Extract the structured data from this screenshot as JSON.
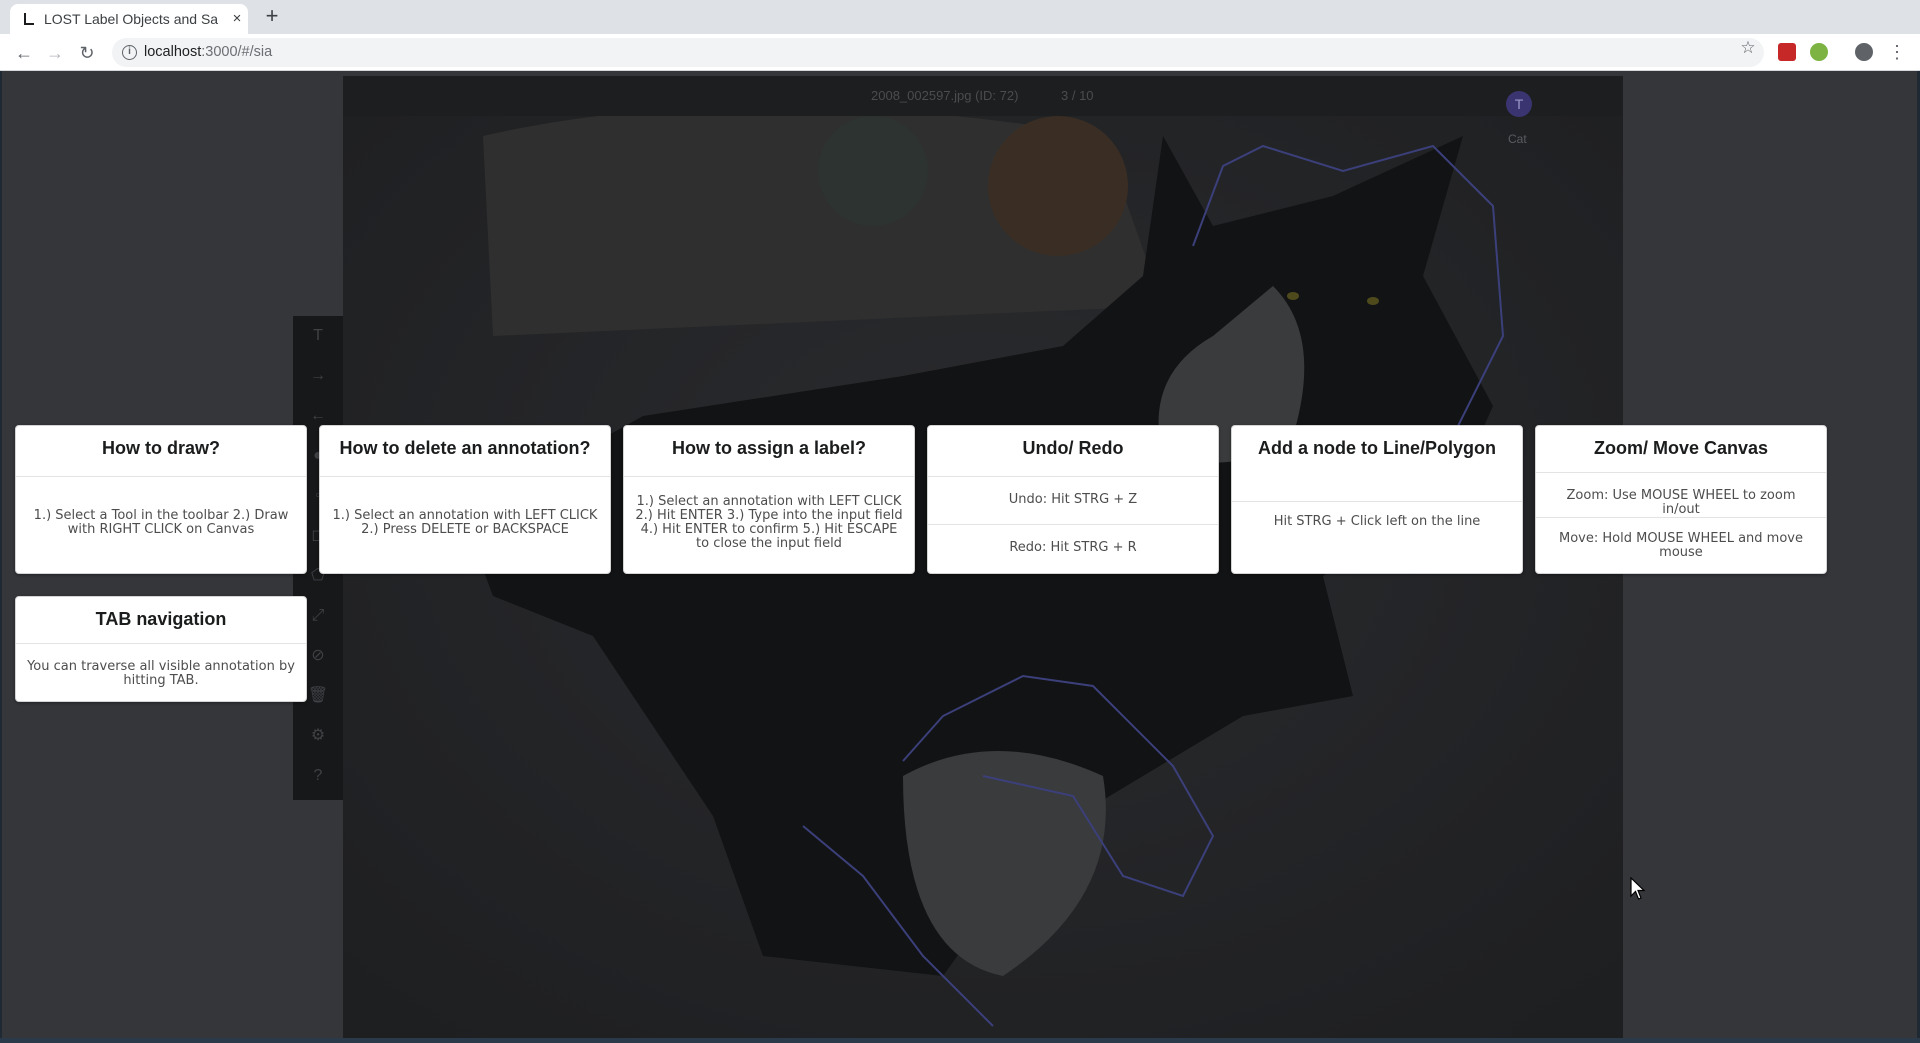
{
  "browser": {
    "tab_title": "LOST Label Objects and Sa",
    "new_tab_glyph": "+",
    "close_glyph": "×",
    "url_host": "localhost",
    "url_path": ":3000/#/sia",
    "icons": {
      "back": "back-arrow-icon",
      "forward": "forward-arrow-icon",
      "reload": "reload-icon",
      "info": "info-icon",
      "star": "bookmark-star-icon",
      "profile": "profile-icon",
      "menu": "kebab-menu-icon"
    }
  },
  "annotation_tool": {
    "image_name": "2008_002597.jpg (ID: 72)",
    "progress": "3 / 10",
    "marker_glyph": "T",
    "label_name": "Cat",
    "toolbar_icons": [
      "text-tool-icon",
      "arrow-right-icon",
      "arrow-left-icon",
      "point-tool-icon",
      "line-tool-icon",
      "bbox-tool-icon",
      "polygon-tool-icon",
      "fullscreen-icon",
      "junk-icon",
      "trash-icon",
      "settings-icon",
      "help-icon"
    ],
    "toolbar_glyphs": [
      "T",
      "→",
      "←",
      "●",
      "◦",
      "◻",
      "⬠",
      "⤢",
      "⊘",
      "🗑",
      "⚙",
      "?"
    ]
  },
  "help_cards": [
    {
      "title": "How to draw?",
      "lines": [
        "1.) Select a Tool in the toolbar 2.) Draw with RIGHT CLICK on Canvas"
      ]
    },
    {
      "title": "How to delete an annotation?",
      "lines": [
        "1.) Select an annotation with LEFT CLICK 2.) Press DELETE or BACKSPACE"
      ]
    },
    {
      "title": "How to assign a label?",
      "lines": [
        "1.) Select an annotation with LEFT CLICK 2.) Hit ENTER 3.) Type into the input field 4.) Hit ENTER to confirm 5.) Hit ESCAPE to close the input field"
      ]
    },
    {
      "title": "Undo/ Redo",
      "lines": [
        "Undo: Hit STRG + Z",
        "Redo: Hit STRG + R"
      ]
    },
    {
      "title": "Add a node to Line/Polygon",
      "lines": [
        "Hit STRG + Click left on the line"
      ]
    },
    {
      "title": "Zoom/ Move Canvas",
      "lines": [
        "Zoom: Use MOUSE WHEEL to zoom in/out",
        "Move: Hold MOUSE WHEEL and move mouse"
      ]
    },
    {
      "title": "TAB navigation",
      "lines": [
        "You can traverse all visible annotation by hitting TAB."
      ]
    }
  ]
}
